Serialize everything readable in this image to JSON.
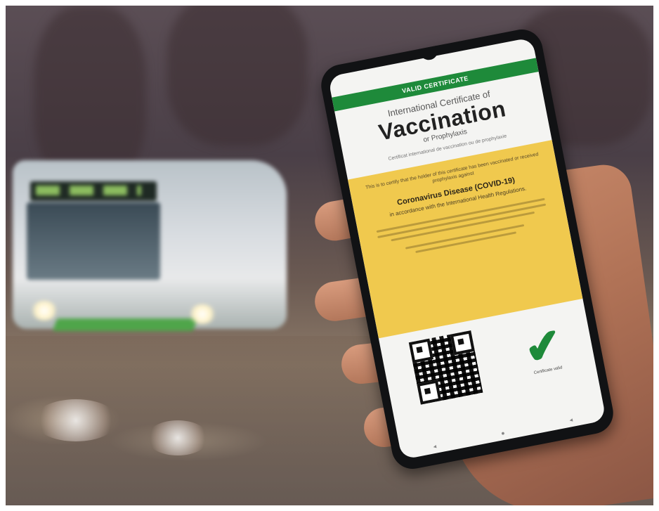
{
  "phone": {
    "status_time": "",
    "banner": "VALID CERTIFICATE",
    "intl_line": "International Certificate of",
    "title": "Vaccination",
    "subtitle": "or Prophylaxis",
    "french_line": "Certificat international de vaccination ou de prophylaxie",
    "attest_text": "This is to certify that the holder of this certificate has been vaccinated or received prophylaxis against",
    "disease": "Coronavirus Disease (COVID-19)",
    "regulations": "in accordance with the International Health Regulations.",
    "validity_label": "Certificate valid",
    "check_glyph": "✔",
    "colors": {
      "banner": "#1e8a3a",
      "card": "#f0c94e",
      "check": "#1e8a3a"
    },
    "icons": [
      "back-nav-icon",
      "home-nav-icon",
      "recent-apps-icon",
      "checkmark-icon",
      "qr-code-icon"
    ]
  }
}
